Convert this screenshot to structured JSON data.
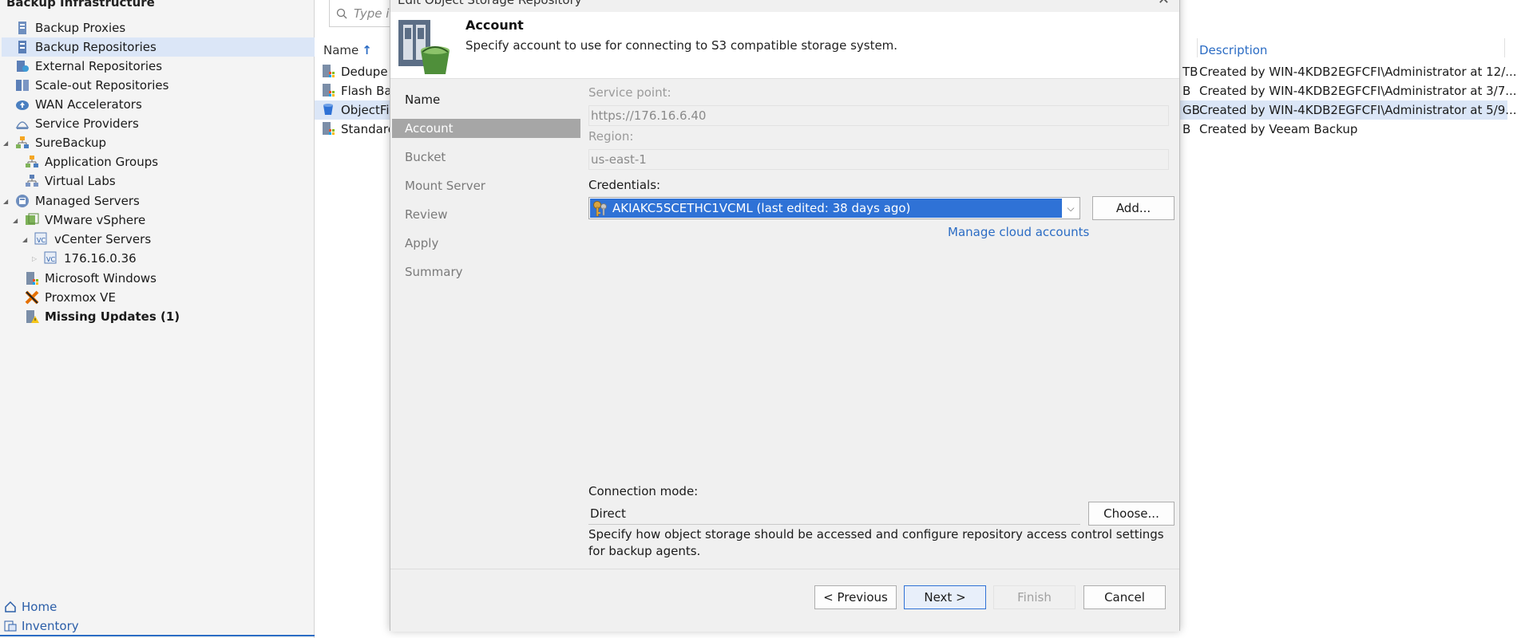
{
  "left_nav": {
    "header": "Backup Infrastructure",
    "items": [
      {
        "label": "Backup Proxies",
        "icon": "backup-proxy-icon"
      },
      {
        "label": "Backup Repositories",
        "icon": "backup-repository-icon"
      },
      {
        "label": "External Repositories",
        "icon": "external-repository-icon"
      },
      {
        "label": "Scale-out Repositories",
        "icon": "scaleout-repository-icon"
      },
      {
        "label": "WAN Accelerators",
        "icon": "wan-accelerator-icon"
      },
      {
        "label": "Service Providers",
        "icon": "service-provider-icon"
      },
      {
        "label": "SureBackup",
        "icon": "surebackup-icon"
      },
      {
        "label": "Application Groups",
        "icon": "application-group-icon"
      },
      {
        "label": "Virtual Labs",
        "icon": "virtual-lab-icon"
      },
      {
        "label": "Managed Servers",
        "icon": "managed-servers-icon"
      },
      {
        "label": "VMware vSphere",
        "icon": "vmware-icon"
      },
      {
        "label": "vCenter Servers",
        "icon": "vcenter-icon"
      },
      {
        "label": "176.16.0.36",
        "icon": "vcenter-server-icon"
      },
      {
        "label": "Microsoft Windows",
        "icon": "windows-server-icon"
      },
      {
        "label": "Proxmox VE",
        "icon": "proxmox-icon"
      },
      {
        "label": "Missing Updates (1)",
        "icon": "missing-updates-icon"
      }
    ],
    "bottom": [
      {
        "label": "Home",
        "icon": "home-icon"
      },
      {
        "label": "Inventory",
        "icon": "inventory-icon"
      }
    ]
  },
  "main": {
    "search_placeholder": "Type in",
    "columns": {
      "name": "Name",
      "description": "Description"
    },
    "rows": [
      {
        "name": "Dedupe I",
        "size_suffix": "TB",
        "description": "Created by WIN-4KDB2EGFCFI\\Administrator at 12/..."
      },
      {
        "name": "Flash Bac",
        "size_suffix": "B",
        "description": "Created by WIN-4KDB2EGFCFI\\Administrator at 3/7..."
      },
      {
        "name": "ObjectFir",
        "size_suffix": "GB",
        "description": "Created by WIN-4KDB2EGFCFI\\Administrator at 5/9..."
      },
      {
        "name": "Standard",
        "size_suffix": "B",
        "description": "Created by Veeam Backup"
      }
    ]
  },
  "dialog": {
    "title": "Edit Object Storage Repository",
    "header_title": "Account",
    "header_subtitle": "Specify account to use for connecting to S3 compatible storage system.",
    "steps": [
      "Name",
      "Account",
      "Bucket",
      "Mount Server",
      "Review",
      "Apply",
      "Summary"
    ],
    "current_step": "Account",
    "service_point_label": "Service point:",
    "service_point_value": "https://176.16.6.40",
    "region_label": "Region:",
    "region_value": "us-east-1",
    "credentials_label": "Credentials:",
    "credentials_value": "AKIAKC5SCETHC1VCML (last edited: 38 days ago)",
    "add_button": "Add...",
    "manage_link": "Manage cloud accounts",
    "connection_mode_label": "Connection mode:",
    "connection_mode_value": "Direct",
    "choose_button": "Choose...",
    "connection_help": "Specify how object storage should be accessed and configure repository access control settings for backup agents.",
    "buttons": {
      "previous": "< Previous",
      "next": "Next >",
      "finish": "Finish",
      "cancel": "Cancel"
    }
  },
  "colors": {
    "selection": "#dbe6f7",
    "accent": "#2f72d6",
    "link": "#2b6cc4",
    "step_current": "#a6a6a6"
  }
}
